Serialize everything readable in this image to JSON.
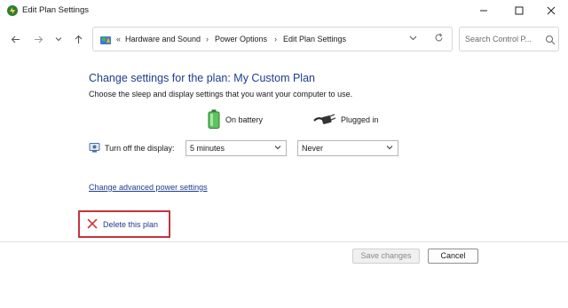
{
  "window": {
    "title": "Edit Plan Settings",
    "icon": "power-plan-icon"
  },
  "nav": {
    "back_icon": "arrow-left-icon",
    "forward_icon": "arrow-right-icon",
    "recent_icon": "chevron-down-icon",
    "up_icon": "arrow-up-icon"
  },
  "address": {
    "overflow": "«",
    "crumbs": [
      "Hardware and Sound",
      "Power Options",
      "Edit Plan Settings"
    ],
    "separator": "›"
  },
  "search": {
    "placeholder": "Search Control P..."
  },
  "main": {
    "heading": "Change settings for the plan: My Custom Plan",
    "subtext": "Choose the sleep and display settings that you want your computer to use.",
    "columns": {
      "battery": "On battery",
      "plugged": "Plugged in"
    },
    "display_row": {
      "label": "Turn off the display:",
      "battery_value": "5 minutes",
      "plugged_value": "Never"
    },
    "advanced_link": "Change advanced power settings",
    "delete_link": "Delete this plan"
  },
  "footer": {
    "save_label": "Save changes",
    "cancel_label": "Cancel"
  },
  "colors": {
    "link": "#1d3d8f",
    "highlight": "#c4343c",
    "battery": "#3cb043"
  }
}
